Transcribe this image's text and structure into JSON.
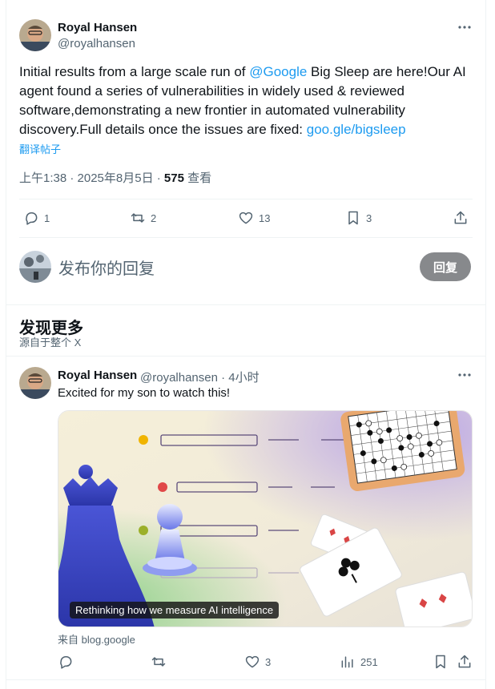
{
  "tweet": {
    "author_name": "Royal Hansen",
    "author_handle": "@royalhansen",
    "text_part1": "Initial results from a large scale run of ",
    "mention": "@Google",
    "text_part2": " Big Sleep are here!Our AI agent found a series of vulnerabilities in widely used & reviewed software,demonstrating a new frontier in automated vulnerability discovery.Full details once the issues are fixed: ",
    "link": "goo.gle/bigsleep",
    "translate": "翻译帖子",
    "timestamp": "上午1:38 · 2025年8月5日 · ",
    "views_count": "575",
    "views_label": " 查看",
    "replies": "1",
    "reposts": "2",
    "likes": "13",
    "bookmarks": "3"
  },
  "reply_box": {
    "placeholder": "发布你的回复",
    "button": "回复"
  },
  "discover": {
    "title": "发现更多",
    "subtitle": "源自于整个 X"
  },
  "tweet2": {
    "author_name": "Royal Hansen",
    "author_handle": "@royalhansen",
    "time": " · 4小时",
    "text": "Excited for my son to watch this!",
    "card_caption": "Rethinking how we measure AI intelligence",
    "card_source": "来自 blog.google",
    "likes": "3",
    "views": "251"
  },
  "colors": {
    "link": "#1d9bf0",
    "secondary_text": "#536471",
    "reply_button": "#87898c"
  }
}
